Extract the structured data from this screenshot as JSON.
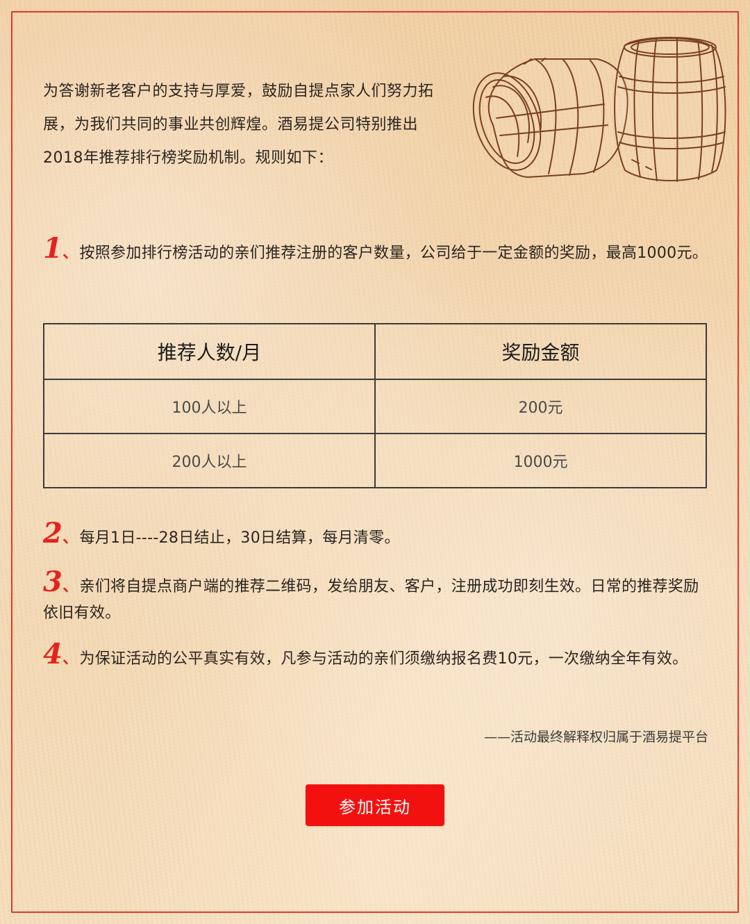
{
  "intro": {
    "text": "为答谢新老客户的支持与厚爱，鼓励自提点家人们努力拓展，为我们共同的事业共创辉煌。酒易提公司特别推出2018年推荐排行榜奖励机制。规则如下："
  },
  "rules": [
    {
      "number": "1",
      "text": "按照参加排行榜活动的亲们推荐注册的客户数量，公司给于一定金额的奖励，最高1000元。"
    },
    {
      "number": "2",
      "text": "每月1日----28日结止，30日结算，每月清零。"
    },
    {
      "number": "3",
      "text": "亲们将自提点商户端的推荐二维码，发给朋友、客户，注册成功即刻生效。日常的推荐奖励依旧有效。"
    },
    {
      "number": "4",
      "text": "为保证活动的公平真实有效，凡参与活动的亲们须缴纳报名费10元，一次缴纳全年有效。"
    }
  ],
  "table": {
    "headers": [
      "推荐人数/月",
      "奖励金额"
    ],
    "rows": [
      [
        "100人以上",
        "200元"
      ],
      [
        "200人以上",
        "1000元"
      ]
    ]
  },
  "footer": {
    "note": "——活动最终解释权归属于酒易提平台"
  },
  "button": {
    "label": "参加活动"
  },
  "colors": {
    "accent": "#e6221d",
    "button": "#f2110f",
    "frame": "#e13a2f"
  },
  "icons": {
    "illustration": "wooden-barrels-sketch"
  }
}
